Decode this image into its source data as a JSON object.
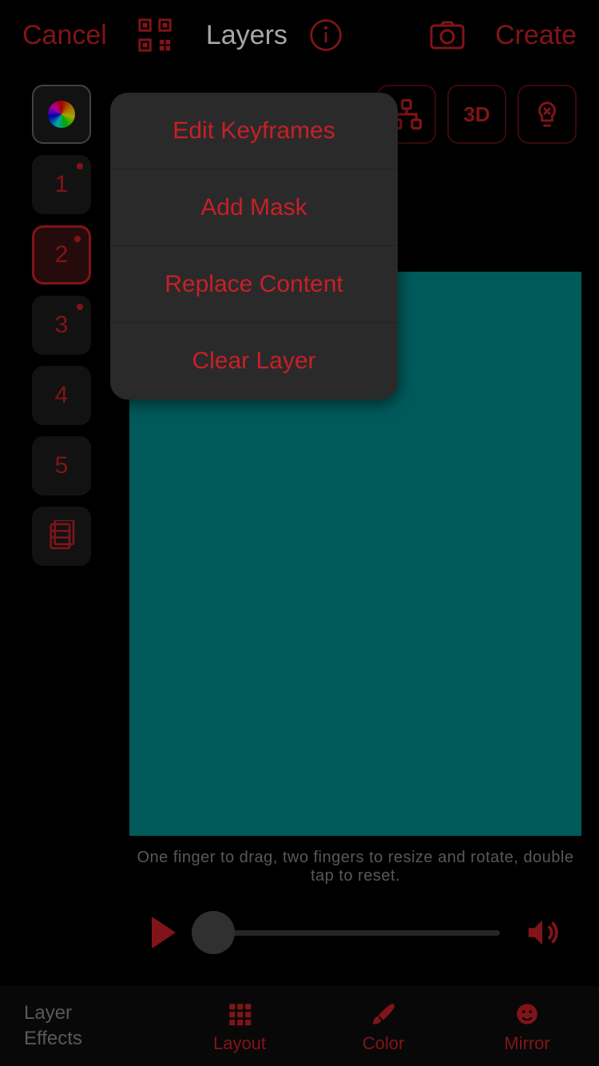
{
  "nav": {
    "cancel": "Cancel",
    "layers": "Layers",
    "create": "Create"
  },
  "popup": {
    "items": [
      "Edit Keyframes",
      "Add Mask",
      "Replace Content",
      "Clear Layer"
    ]
  },
  "layers": {
    "list": [
      "1",
      "2",
      "3",
      "4",
      "5"
    ],
    "selected_index": 1
  },
  "toolbar": {
    "threeD": "3D"
  },
  "hint_text": "One finger to drag, two fingers to resize and rotate, double tap to reset.",
  "canvas_color": "#008b8b",
  "tabs": {
    "effects_line1": "Layer",
    "effects_line2": "Effects",
    "layout": "Layout",
    "color": "Color",
    "mirror": "Mirror"
  },
  "accent": "#c72027"
}
